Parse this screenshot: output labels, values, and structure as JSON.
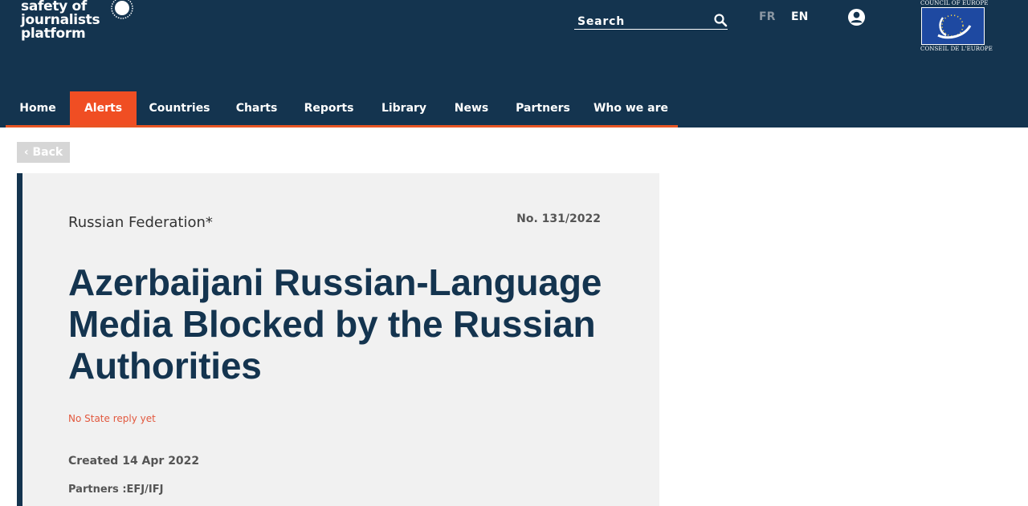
{
  "logo": {
    "lines": [
      "safety of",
      "journalists",
      "platform"
    ]
  },
  "search": {
    "label": "Search"
  },
  "languages": {
    "fr": "FR",
    "en": "EN"
  },
  "council": {
    "top": "COUNCIL OF EUROPE",
    "bottom": "CONSEIL DE L'EUROPE"
  },
  "nav": {
    "items": [
      {
        "label": "Home"
      },
      {
        "label": "Alerts"
      },
      {
        "label": "Countries"
      },
      {
        "label": "Charts"
      },
      {
        "label": "Reports"
      },
      {
        "label": "Library"
      },
      {
        "label": "News"
      },
      {
        "label": "Partners"
      },
      {
        "label": "Who we are"
      }
    ],
    "active_index": 1
  },
  "back": {
    "label": "‹ Back"
  },
  "alert": {
    "country": "Russian Federation*",
    "number": "No. 131/2022",
    "title": "Azerbaijani Russian-Language Media Blocked by the Russian Authorities",
    "reply_status": "No State reply yet",
    "created": "Created 14 Apr 2022",
    "partners": "Partners :EFJ/IFJ"
  },
  "colors": {
    "header_bg": "#14344f",
    "accent": "#f04e23",
    "reply_status": "#e2583e",
    "card_bg": "#f1f1f1"
  }
}
